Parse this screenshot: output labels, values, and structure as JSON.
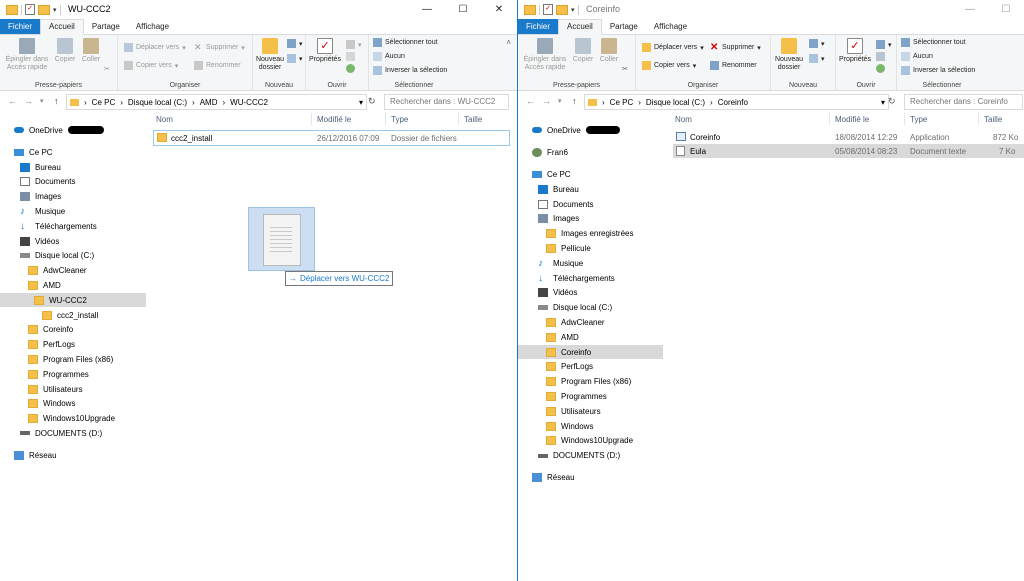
{
  "left": {
    "title": "WU-CCC2",
    "tabs": [
      "Fichier",
      "Accueil",
      "Partage",
      "Affichage"
    ],
    "ribbon": {
      "pin": "Épingler dans Accès rapide",
      "copy": "Copier",
      "paste": "Coller",
      "clipboard_group": "Presse-papiers",
      "move_to": "Déplacer vers",
      "copy_to": "Copier vers",
      "delete": "Supprimer",
      "rename": "Renommer",
      "organize_group": "Organiser",
      "new_folder": "Nouveau dossier",
      "new_group": "Nouveau",
      "properties": "Propriétés",
      "open_group": "Ouvrir",
      "select_all": "Sélectionner tout",
      "select_none": "Aucun",
      "invert_selection": "Inverser la sélection",
      "select_group": "Sélectionner"
    },
    "breadcrumb": [
      "Ce PC",
      "Disque local (C:)",
      "AMD",
      "WU-CCC2"
    ],
    "search_placeholder": "Rechercher dans : WU-CCC2",
    "nav": [
      "OneDrive",
      "Ce PC",
      "Bureau",
      "Documents",
      "Images",
      "Musique",
      "Téléchargements",
      "Vidéos",
      "Disque local (C:)",
      "AdwCleaner",
      "AMD",
      "WU-CCC2",
      "ccc2_install",
      "Coreinfo",
      "PerfLogs",
      "Program Files (x86)",
      "Programmes",
      "Utilisateurs",
      "Windows",
      "Windows10Upgrade",
      "DOCUMENTS (D:)",
      "Réseau"
    ],
    "columns": [
      "Nom",
      "Modifié le",
      "Type",
      "Taille"
    ],
    "files": [
      {
        "name": "ccc2_install",
        "modified": "26/12/2016 07:09",
        "type": "Dossier de fichiers",
        "size": ""
      }
    ],
    "drag_tooltip": "Déplacer vers WU-CCC2"
  },
  "right": {
    "title": "Coreinfo",
    "tabs": [
      "Fichier",
      "Accueil",
      "Partage",
      "Affichage"
    ],
    "ribbon": {
      "pin": "Épingler dans Accès rapide",
      "copy": "Copier",
      "paste": "Coller",
      "clipboard_group": "Presse-papiers",
      "move_to": "Déplacer vers",
      "copy_to": "Copier vers",
      "delete": "Supprimer",
      "rename": "Renommer",
      "organize_group": "Organiser",
      "new_folder": "Nouveau dossier",
      "new_group": "Nouveau",
      "properties": "Propriétés",
      "open_group": "Ouvrir",
      "select_all": "Sélectionner tout",
      "select_none": "Aucun",
      "invert_selection": "Inverser la sélection",
      "select_group": "Sélectionner"
    },
    "breadcrumb": [
      "Ce PC",
      "Disque local (C:)",
      "Coreinfo"
    ],
    "search_placeholder": "Rechercher dans : Coreinfo",
    "nav": [
      "OneDrive",
      "Fran6",
      "Ce PC",
      "Bureau",
      "Documents",
      "Images",
      "Images enregistrées",
      "Pellicule",
      "Musique",
      "Téléchargements",
      "Vidéos",
      "Disque local (C:)",
      "AdwCleaner",
      "AMD",
      "Coreinfo",
      "PerfLogs",
      "Program Files (x86)",
      "Programmes",
      "Utilisateurs",
      "Windows",
      "Windows10Upgrade",
      "DOCUMENTS (D:)",
      "Réseau"
    ],
    "columns": [
      "Nom",
      "Modifié le",
      "Type",
      "Taille"
    ],
    "files": [
      {
        "name": "Coreinfo",
        "modified": "18/08/2014 12:29",
        "type": "Application",
        "size": "872 Ko"
      },
      {
        "name": "Eula",
        "modified": "05/08/2014 08:23",
        "type": "Document texte",
        "size": "7 Ko"
      }
    ]
  }
}
